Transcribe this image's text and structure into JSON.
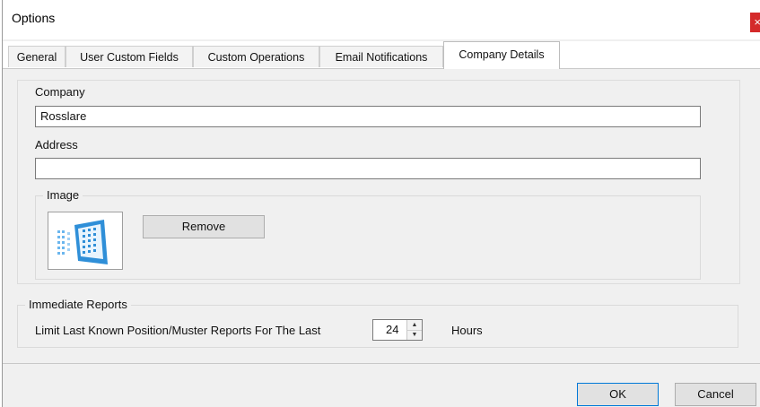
{
  "window": {
    "title": "Options",
    "close_glyph": "×"
  },
  "tabs": [
    {
      "label": "General",
      "active": false
    },
    {
      "label": "User Custom Fields",
      "active": false
    },
    {
      "label": "Custom Operations",
      "active": false
    },
    {
      "label": "Email Notifications",
      "active": false
    },
    {
      "label": "Company Details",
      "active": true
    }
  ],
  "company_details": {
    "company_label": "Company",
    "company_value": "Rosslare",
    "address_label": "Address",
    "address_value": "",
    "image_group_label": "Image",
    "image_icon": "building-logo-icon",
    "remove_button": "Remove"
  },
  "immediate_reports": {
    "group_label": "Immediate Reports",
    "limit_label": "Limit Last Known Position/Muster Reports For The Last",
    "hours_value": "24",
    "hours_unit": "Hours"
  },
  "footer": {
    "ok_label": "OK",
    "cancel_label": "Cancel"
  },
  "colors": {
    "close_button": "#d42a2a",
    "default_button_border": "#0078d7",
    "logo_blue": "#2f8fd8"
  }
}
